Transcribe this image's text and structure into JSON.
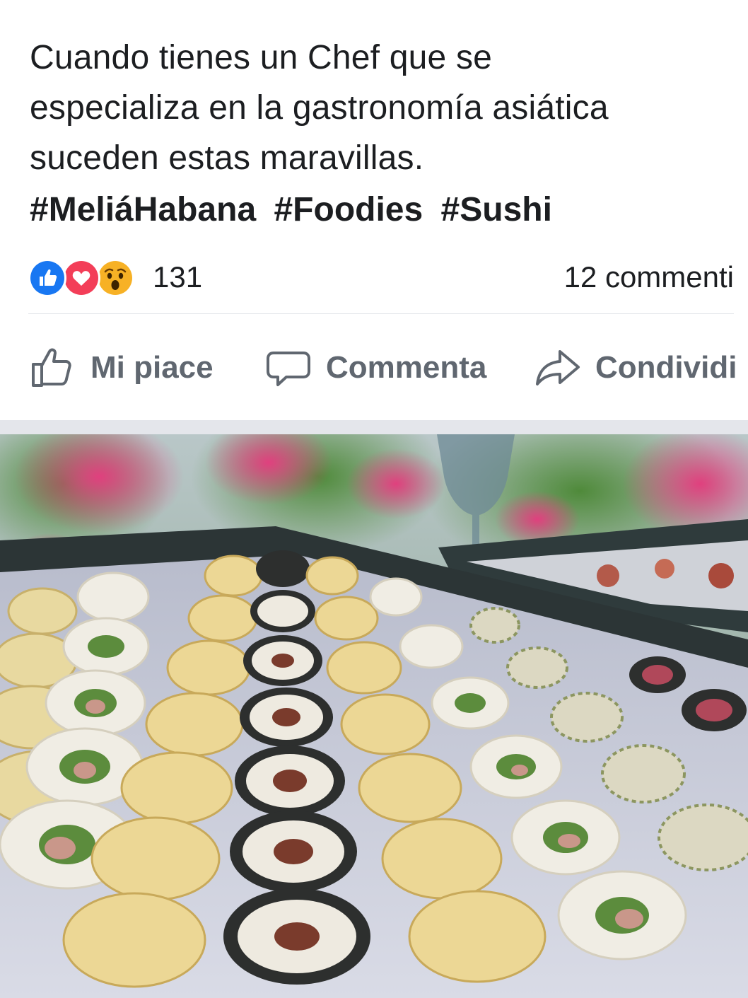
{
  "post": {
    "text_lines": [
      "Cuando tienes un Chef que se",
      "especializa en la gastronomía asiática",
      "suceden estas maravillas."
    ],
    "hashtags": [
      "#MeliáHabana",
      "#Foodies",
      "#Sushi"
    ]
  },
  "reactions": {
    "icons": [
      "like-icon",
      "love-icon",
      "wow-icon"
    ],
    "count": "131",
    "comments": "12 commenti"
  },
  "actions": {
    "like_label": "Mi piace",
    "comment_label": "Commenta",
    "share_label": "Condividi"
  },
  "colors": {
    "like_blue": "#1877f2",
    "love_red": "#f33e58",
    "wow_yellow": "#f7b125",
    "action_gray": "#606770",
    "text": "#1c1e21"
  },
  "photo": {
    "subject": "sushi-platter-photo"
  }
}
